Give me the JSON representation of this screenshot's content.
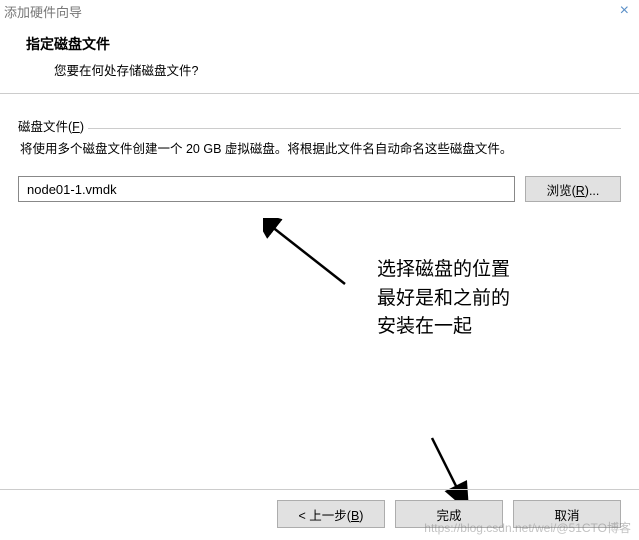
{
  "window": {
    "title": "添加硬件向导"
  },
  "header": {
    "title": "指定磁盘文件",
    "subtitle": "您要在何处存储磁盘文件?"
  },
  "group": {
    "label_pre": "磁盘文件(",
    "label_key": "F",
    "label_post": ")",
    "description": "将使用多个磁盘文件创建一个 20 GB 虚拟磁盘。将根据此文件名自动命名这些磁盘文件。"
  },
  "file": {
    "value": "node01-1.vmdk",
    "browse_pre": "浏览(",
    "browse_key": "R",
    "browse_post": ")..."
  },
  "annotations": {
    "note": "选择磁盘的位置\n最好是和之前的\n安装在一起"
  },
  "buttons": {
    "back_pre": "< 上一步(",
    "back_key": "B",
    "back_post": ")",
    "finish": "完成",
    "cancel": "取消"
  },
  "watermark": "https://blog.csdn.net/wei/@51CTO博客"
}
